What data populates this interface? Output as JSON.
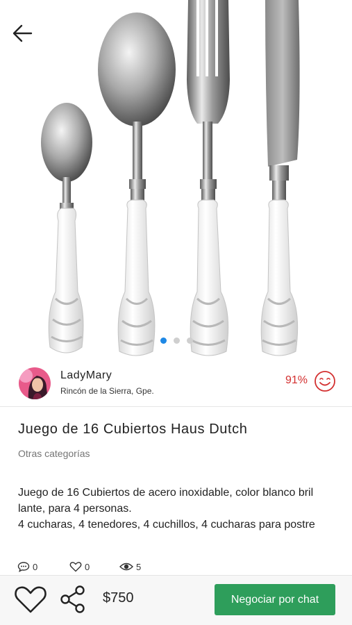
{
  "gallery": {
    "image_alt": "cutlery-set-photo",
    "dots": [
      true,
      false,
      false
    ],
    "active_color": "#1e88e5"
  },
  "seller": {
    "name": "LadyMary",
    "location": "Rincón de la Sierra, Gpe.",
    "rating": "91%"
  },
  "listing": {
    "title": "Juego de 16 Cubiertos Haus Dutch",
    "category": "Otras categorías",
    "description": "Juego de 16 Cubiertos de acero inoxidable, color blanco bril\nlante, para 4 personas.\n4 cucharas, 4 tenedores, 4 cuchillos, 4 cucharas para postre"
  },
  "stats": {
    "comments": "0",
    "likes": "0",
    "views": "5"
  },
  "actions": {
    "price": "$750",
    "chat_label": "Negociar por chat",
    "chat_color": "#2e9e5b",
    "rating_color": "#d32f2f"
  }
}
